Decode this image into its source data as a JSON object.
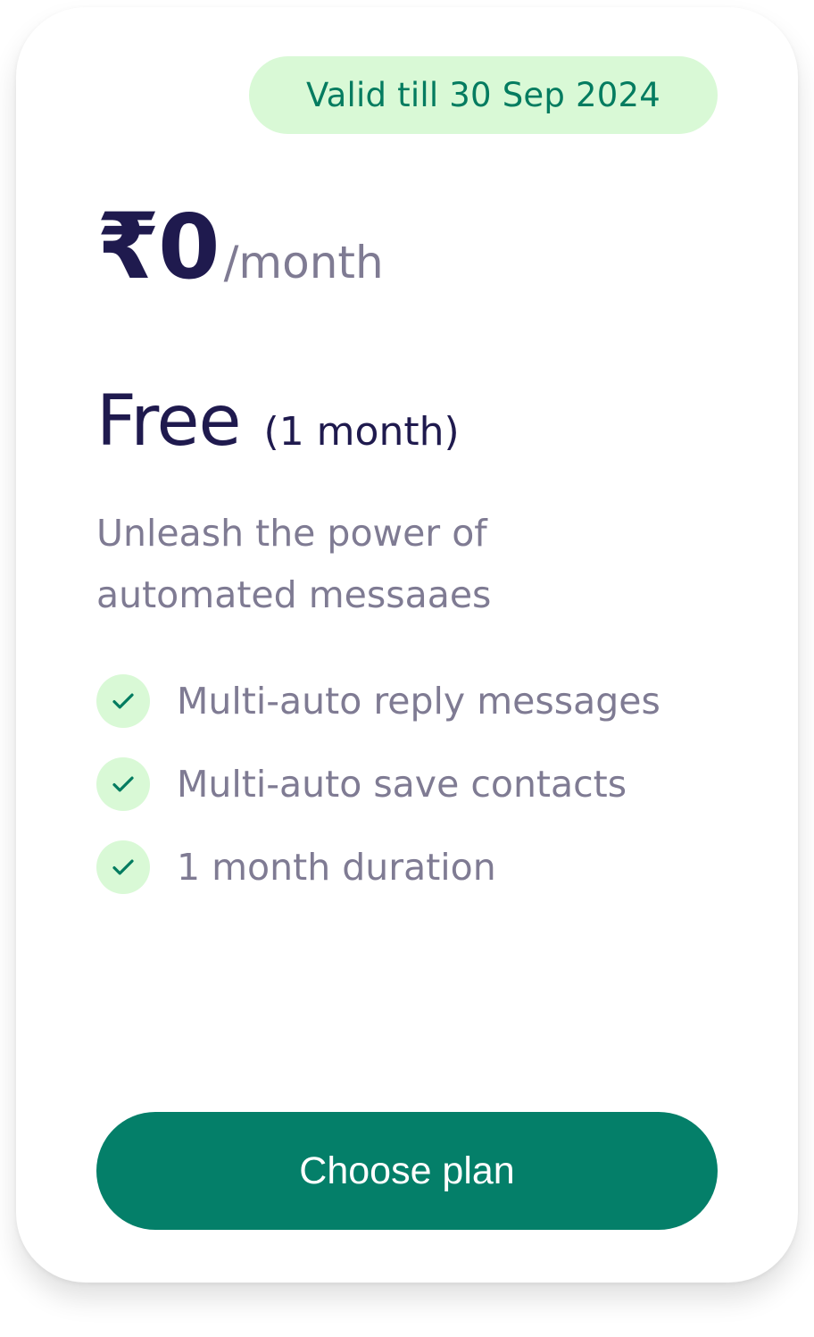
{
  "card": {
    "badge": "Valid till 30 Sep 2024",
    "price": {
      "currency": "₹",
      "amount": "0",
      "period": "/month"
    },
    "plan": {
      "name": "Free",
      "duration": "(1 month)"
    },
    "description": "Unleash the power of automated messaaes",
    "features": [
      {
        "label": "Multi-auto reply messages",
        "icon": "check-icon"
      },
      {
        "label": "Multi-auto save contacts",
        "icon": "check-icon"
      },
      {
        "label": "1 month duration",
        "icon": "check-icon"
      }
    ],
    "cta_label": "Choose plan"
  },
  "colors": {
    "primary": "#047f69",
    "badge_bg": "#d9f9d6",
    "badge_text": "#047c60",
    "heading": "#1f1a4e",
    "muted": "#7f7b93"
  }
}
